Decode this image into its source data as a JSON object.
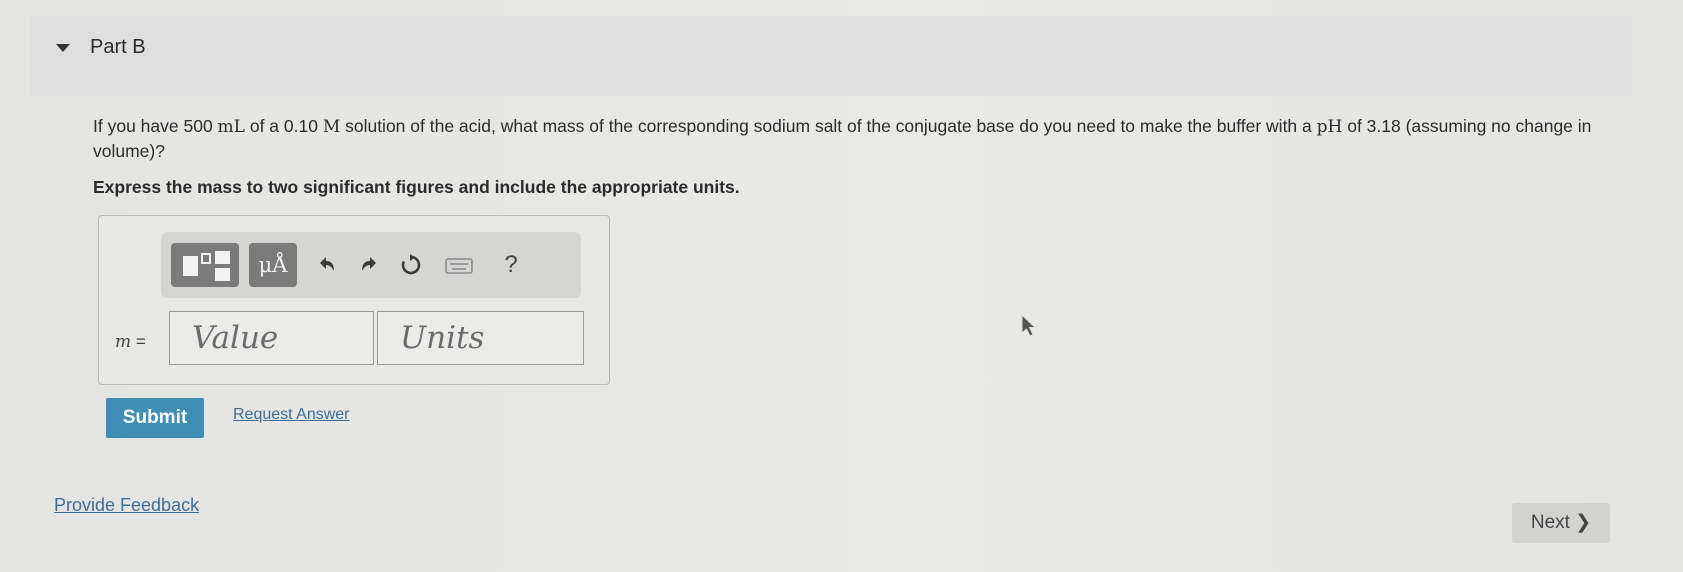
{
  "part": {
    "title": "Part B",
    "toggle_icon": "caret-down-icon"
  },
  "question": {
    "text_1": "If you have 500 ",
    "unit_ml": "mL",
    "text_2": " of a 0.10 ",
    "unit_m": "M",
    "text_3": " solution of the acid, what mass of the corresponding sodium salt of the conjugate base do you need to make the buffer with a ",
    "ph": "pH",
    "text_4": " of 3.18 (assuming no change in volume)?"
  },
  "instruction": "Express the mass to two significant figures and include the appropriate units.",
  "toolbar": {
    "template_icon": "templates-icon",
    "units_label": "μÅ",
    "undo_icon": "undo-icon",
    "redo_icon": "redo-icon",
    "reset_icon": "reset-icon",
    "keyboard_icon": "keyboard-icon",
    "help_label": "?"
  },
  "answer": {
    "variable": "m",
    "equals": " =",
    "value_placeholder": "Value",
    "units_placeholder": "Units"
  },
  "actions": {
    "submit_label": "Submit",
    "request_label": "Request Answer"
  },
  "footer": {
    "feedback_label": "Provide Feedback",
    "next_label": "Next ❯"
  },
  "colors": {
    "submit_bg": "#3e8fb3",
    "link": "#3d6f9a",
    "toolbar_button": "#7b7b7b"
  }
}
